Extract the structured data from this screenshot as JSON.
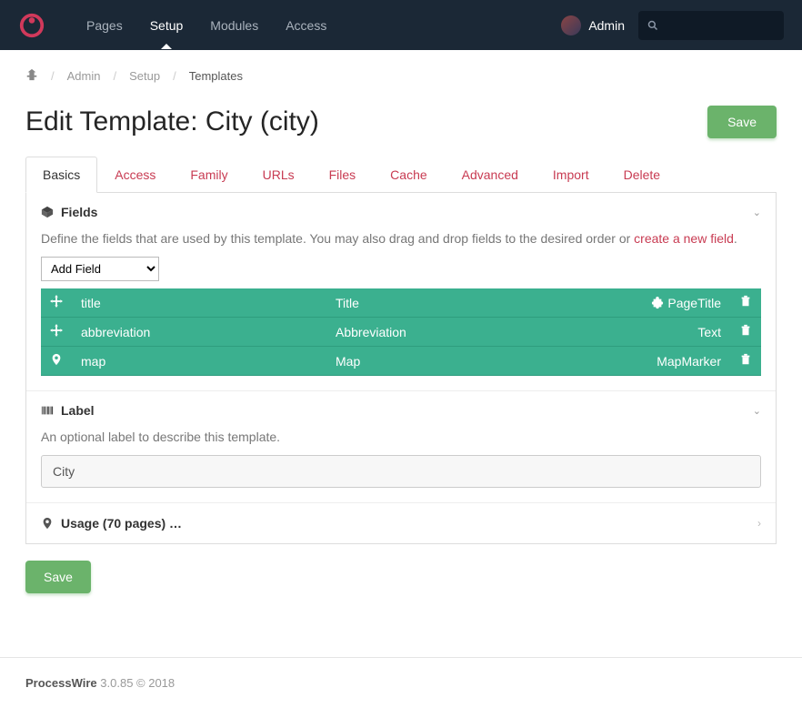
{
  "nav": {
    "items": [
      "Pages",
      "Setup",
      "Modules",
      "Access"
    ],
    "active_index": 1
  },
  "user": {
    "name": "Admin"
  },
  "search": {
    "placeholder": ""
  },
  "breadcrumb": {
    "items": [
      "Admin",
      "Setup",
      "Templates"
    ]
  },
  "page": {
    "title": "Edit Template: City (city)",
    "save_label": "Save"
  },
  "tabs": {
    "items": [
      "Basics",
      "Access",
      "Family",
      "URLs",
      "Files",
      "Cache",
      "Advanced",
      "Import",
      "Delete"
    ],
    "active_index": 0
  },
  "fields_section": {
    "title": "Fields",
    "description_pre": "Define the fields that are used by this template. You may also drag and drop fields to the desired order or ",
    "description_link": "create a new field",
    "description_post": ".",
    "add_field_label": "Add Field",
    "rows": [
      {
        "icon": "move",
        "name": "title",
        "label": "Title",
        "type": "PageTitle",
        "type_icon": "puzzle"
      },
      {
        "icon": "move",
        "name": "abbreviation",
        "label": "Abbreviation",
        "type": "Text",
        "type_icon": ""
      },
      {
        "icon": "marker",
        "name": "map",
        "label": "Map",
        "type": "MapMarker",
        "type_icon": ""
      }
    ]
  },
  "label_section": {
    "title": "Label",
    "description": "An optional label to describe this template.",
    "value": "City"
  },
  "usage_section": {
    "title": "Usage (70 pages) …"
  },
  "footer": {
    "product": "ProcessWire",
    "version": "3.0.85 © 2018"
  },
  "colors": {
    "accent": "#c83b52",
    "teal": "#3bb08f",
    "green": "#6bb36b",
    "dark": "#1b2836"
  }
}
